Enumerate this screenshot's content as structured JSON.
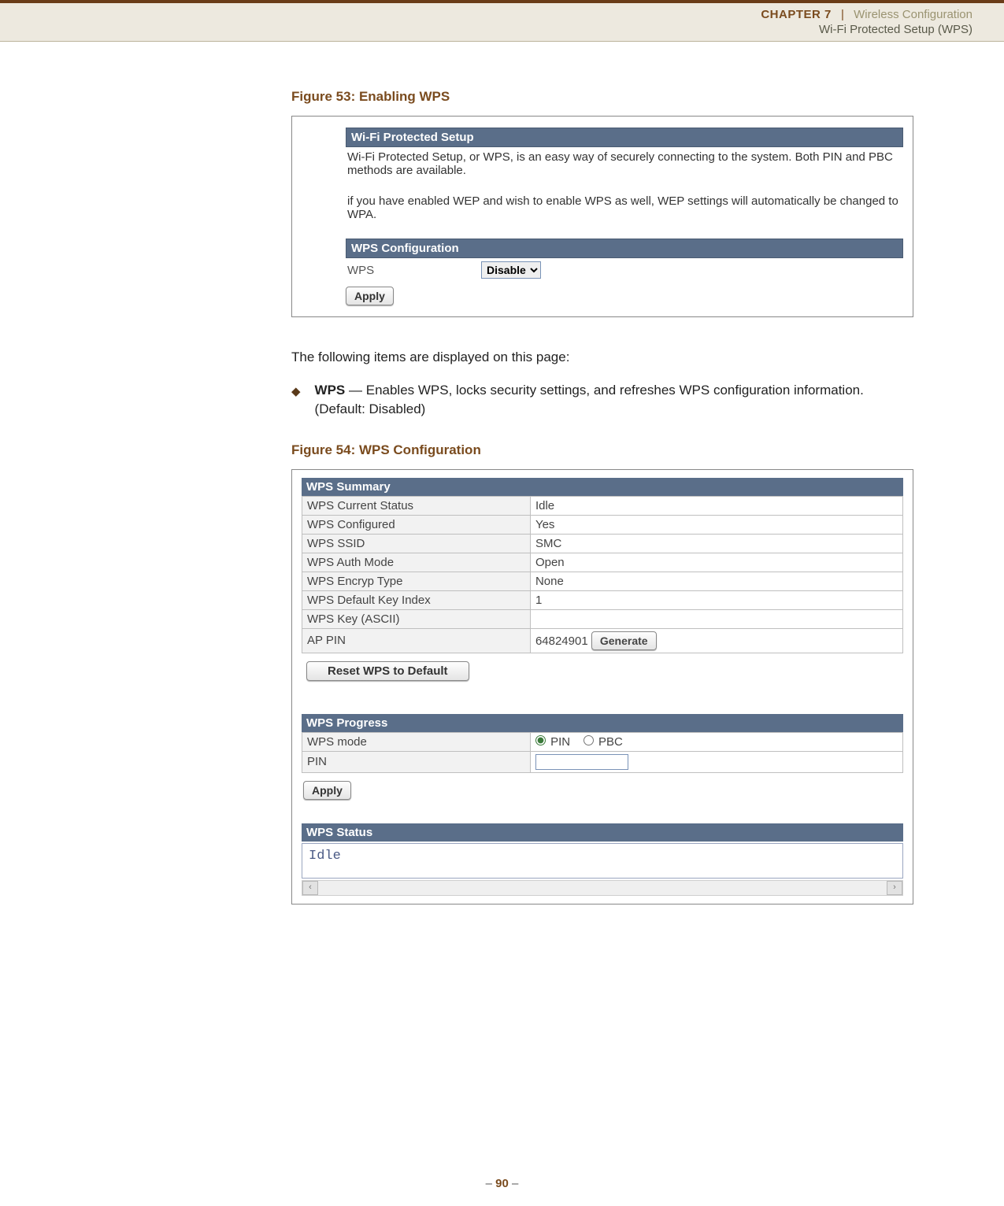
{
  "header": {
    "chapter": "CHAPTER 7",
    "separator": "|",
    "section": "Wireless Configuration",
    "subsection": "Wi-Fi Protected Setup (WPS)"
  },
  "fig53": {
    "caption": "Figure 53:  Enabling WPS",
    "panel1_title": "Wi-Fi Protected Setup",
    "desc1": "Wi-Fi Protected Setup, or WPS, is an easy way of securely connecting to the system. Both PIN and PBC methods are available.",
    "desc2": "if you have enabled WEP and wish to enable WPS as well, WEP settings will automatically be changed to WPA.",
    "panel2_title": "WPS Configuration",
    "wps_label": "WPS",
    "wps_value": "Disable",
    "apply": "Apply"
  },
  "body": {
    "intro": "The following items are displayed on this page:",
    "bullet_label": "WPS",
    "bullet_text": " — Enables WPS, locks security settings, and refreshes WPS configuration information. (Default: Disabled)"
  },
  "fig54": {
    "caption": "Figure 54:  WPS Configuration",
    "summary_title": "WPS Summary",
    "rows": [
      {
        "k": "WPS Current Status",
        "v": "Idle"
      },
      {
        "k": "WPS Configured",
        "v": "Yes"
      },
      {
        "k": "WPS SSID",
        "v": "SMC"
      },
      {
        "k": "WPS Auth Mode",
        "v": "Open"
      },
      {
        "k": "WPS Encryp Type",
        "v": "None"
      },
      {
        "k": "WPS Default Key Index",
        "v": "1"
      },
      {
        "k": "WPS Key (ASCII)",
        "v": ""
      }
    ],
    "ap_pin_label": "AP PIN",
    "ap_pin_value": "64824901",
    "generate": "Generate",
    "reset": "Reset WPS to Default",
    "progress_title": "WPS Progress",
    "mode_label": "WPS mode",
    "mode_pin": "PIN",
    "mode_pbc": "PBC",
    "pin_label": "PIN",
    "apply": "Apply",
    "status_title": "WPS Status",
    "status_value": "Idle"
  },
  "footer": {
    "dash": "–  ",
    "page": "90",
    "dash2": "  –"
  }
}
